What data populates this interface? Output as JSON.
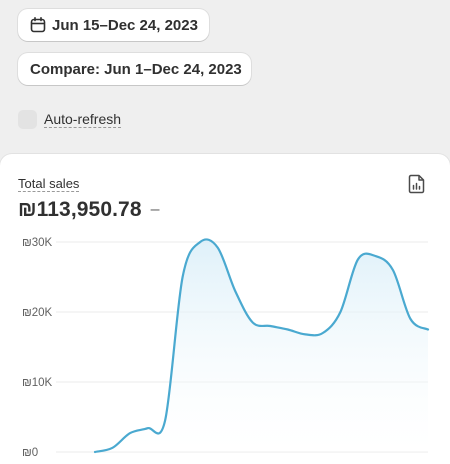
{
  "toolbar": {
    "date_range_label": "Jun 15–Dec 24, 2023",
    "compare_label": "Compare: Jun 1–Dec 24, 2023",
    "auto_refresh_label": "Auto-refresh",
    "auto_refresh_checked": false,
    "calendar_icon": "calendar-icon"
  },
  "card": {
    "title": "Total sales",
    "total": "₪113,950.78",
    "change": "–",
    "export_icon": "report-icon"
  },
  "colors": {
    "line": "#4aa9d0",
    "fill": "#dff0f8",
    "grid": "#ebebeb",
    "page_bg": "#efefef"
  },
  "chart_data": {
    "type": "area",
    "ylabel": "",
    "ylim": [
      0,
      30000
    ],
    "yticks": [
      {
        "value": 30000,
        "label": "₪30K"
      },
      {
        "value": 20000,
        "label": "₪20K"
      },
      {
        "value": 10000,
        "label": "₪10K"
      },
      {
        "value": 0,
        "label": "₪0"
      }
    ],
    "series": [
      {
        "values": [
          0,
          600,
          2700,
          3400,
          4500,
          25000,
          30000,
          29200,
          23000,
          18500,
          18000,
          17500,
          16800,
          17000,
          20000,
          27500,
          28000,
          26000,
          19000,
          17500
        ]
      }
    ]
  }
}
